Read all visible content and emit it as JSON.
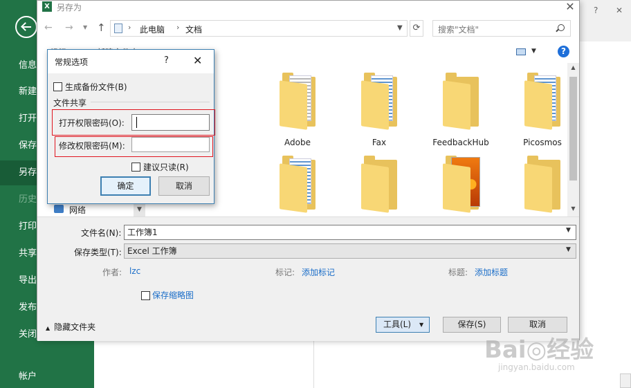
{
  "backstage": {
    "items": [
      {
        "label": "信息"
      },
      {
        "label": "新建"
      },
      {
        "label": "打开"
      },
      {
        "label": "保存"
      },
      {
        "label": "另存"
      },
      {
        "label": "历史"
      },
      {
        "label": "打印"
      },
      {
        "label": "共享"
      },
      {
        "label": "导出"
      },
      {
        "label": "发布"
      },
      {
        "label": "关闭"
      },
      {
        "label": "帐户"
      }
    ]
  },
  "save_as": {
    "title": "另存为",
    "app_icon_text": "X",
    "breadcrumb": {
      "root": "此电脑",
      "folder": "文档"
    },
    "search": {
      "placeholder": "搜索\"文档\""
    },
    "toolbar": {
      "organize": "组织 ▾",
      "new_folder": "新建文件夹"
    },
    "nav": {
      "network": "网络"
    },
    "folders": [
      {
        "label": "Adobe"
      },
      {
        "label": "Fax"
      },
      {
        "label": "FeedbackHub"
      },
      {
        "label": "Picosmos"
      },
      {
        "label": ""
      },
      {
        "label": ""
      },
      {
        "label": ""
      },
      {
        "label": ""
      }
    ],
    "file_name_label": "文件名(N):",
    "file_name_value": "工作簿1",
    "file_type_label": "保存类型(T):",
    "file_type_value": "Excel 工作簿",
    "meta": {
      "author_label": "作者:",
      "author_value": "lzc",
      "tags_label": "标记:",
      "tags_value": "添加标记",
      "title_label": "标题:",
      "title_value": "添加标题"
    },
    "thumbnail_label": "保存缩略图",
    "hide_folders": "隐藏文件夹",
    "tools_label": "工具(L)",
    "save_label": "保存(S)",
    "cancel_label": "取消"
  },
  "general_options": {
    "title": "常规选项",
    "help": "?",
    "close": "✕",
    "backup_label": "生成备份文件(B)",
    "sharing_label": "文件共享",
    "open_password_label": "打开权限密码(O):",
    "open_password_value": "",
    "modify_password_label": "修改权限密码(M):",
    "modify_password_value": "",
    "readonly_label": "建议只读(R)",
    "ok_label": "确定",
    "cancel_label": "取消"
  },
  "watermark": {
    "logo": "Bai◎经验",
    "url": "jingyan.baidu.com"
  }
}
